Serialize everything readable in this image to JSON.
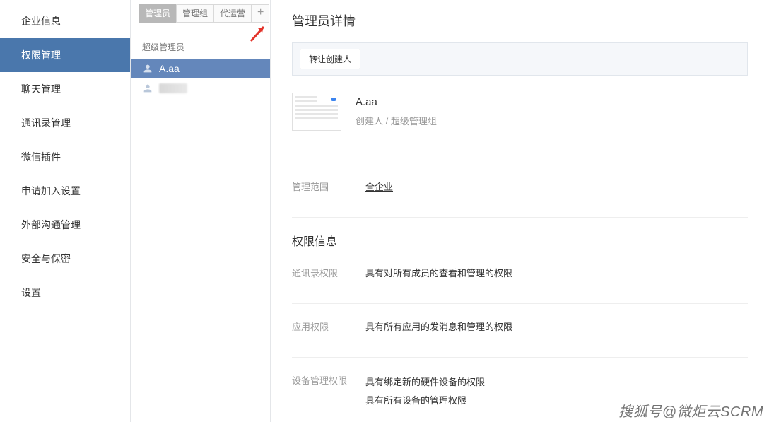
{
  "sidebar": {
    "items": [
      {
        "label": "企业信息"
      },
      {
        "label": "权限管理"
      },
      {
        "label": "聊天管理"
      },
      {
        "label": "通讯录管理"
      },
      {
        "label": "微信插件"
      },
      {
        "label": "申请加入设置"
      },
      {
        "label": "外部沟通管理"
      },
      {
        "label": "安全与保密"
      },
      {
        "label": "设置"
      }
    ],
    "active_index": 1
  },
  "admin_column": {
    "tabs": [
      {
        "label": "管理员"
      },
      {
        "label": "管理组"
      },
      {
        "label": "代运营"
      }
    ],
    "active_tab_index": 0,
    "group_title": "超级管理员",
    "admins": [
      {
        "name": "A.aa",
        "selected": true
      },
      {
        "name": "",
        "selected": false
      }
    ]
  },
  "detail": {
    "title": "管理员详情",
    "transfer_button": "转让创建人",
    "profile": {
      "name": "A.aa",
      "role": "创建人 / 超级管理组"
    },
    "scope": {
      "label": "管理范围",
      "value": "全企业"
    },
    "perm_section_title": "权限信息",
    "permissions": [
      {
        "label": "通讯录权限",
        "values": [
          "具有对所有成员的查看和管理的权限"
        ]
      },
      {
        "label": "应用权限",
        "values": [
          "具有所有应用的发消息和管理的权限"
        ]
      },
      {
        "label": "设备管理权限",
        "values": [
          "具有绑定新的硬件设备的权限",
          "具有所有设备的管理权限"
        ]
      }
    ]
  },
  "watermark": "搜狐号@微炬云SCRM"
}
